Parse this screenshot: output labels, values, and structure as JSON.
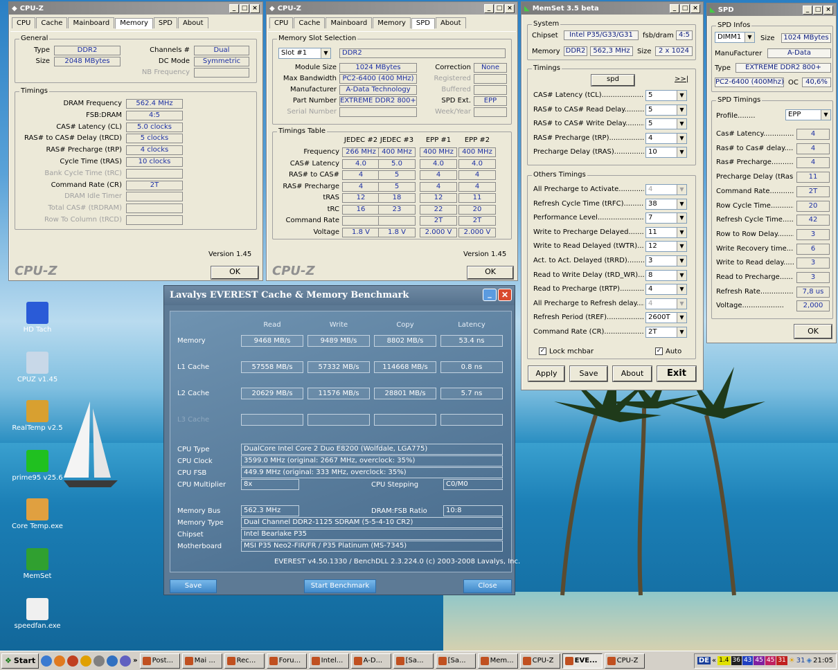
{
  "cpuz1": {
    "title": "CPU-Z",
    "tabs": [
      "CPU",
      "Cache",
      "Mainboard",
      "Memory",
      "SPD",
      "About"
    ],
    "active_tab": "Memory",
    "general_label": "General",
    "type_label": "Type",
    "type_value": "DDR2",
    "size_label": "Size",
    "size_value": "2048 MBytes",
    "channels_label": "Channels #",
    "channels_value": "Dual",
    "dcmode_label": "DC Mode",
    "dcmode_value": "Symmetric",
    "nbfreq_label": "NB Frequency",
    "timings_label": "Timings",
    "rows": [
      {
        "label": "DRAM Frequency",
        "value": "562.4 MHz",
        "dim": false
      },
      {
        "label": "FSB:DRAM",
        "value": "4:5",
        "dim": false
      },
      {
        "label": "CAS# Latency (CL)",
        "value": "5.0 clocks",
        "dim": false
      },
      {
        "label": "RAS# to CAS# Delay (tRCD)",
        "value": "5 clocks",
        "dim": false
      },
      {
        "label": "RAS# Precharge (tRP)",
        "value": "4 clocks",
        "dim": false
      },
      {
        "label": "Cycle Time (tRAS)",
        "value": "10 clocks",
        "dim": false
      },
      {
        "label": "Bank Cycle Time (tRC)",
        "value": "",
        "dim": true
      },
      {
        "label": "Command Rate (CR)",
        "value": "2T",
        "dim": false
      },
      {
        "label": "DRAM Idle Timer",
        "value": "",
        "dim": true
      },
      {
        "label": "Total CAS# (tRDRAM)",
        "value": "",
        "dim": true
      },
      {
        "label": "Row To Column (tRCD)",
        "value": "",
        "dim": true
      }
    ],
    "version": "Version 1.45",
    "logo": "CPU-Z",
    "ok": "OK"
  },
  "cpuz2": {
    "title": "CPU-Z",
    "tabs": [
      "CPU",
      "Cache",
      "Mainboard",
      "Memory",
      "SPD",
      "About"
    ],
    "active_tab": "SPD",
    "slot_group": "Memory Slot Selection",
    "slot_value": "Slot #1",
    "slot_type": "DDR2",
    "module_size_label": "Module Size",
    "module_size": "1024 MBytes",
    "max_bw_label": "Max Bandwidth",
    "max_bw": "PC2-6400 (400 MHz)",
    "manufacturer_label": "Manufacturer",
    "manufacturer": "A-Data Technology",
    "part_label": "Part Number",
    "part": "EXTREME DDR2 800+",
    "serial_label": "Serial Number",
    "correction_label": "Correction",
    "correction": "None",
    "registered_label": "Registered",
    "buffered_label": "Buffered",
    "spdext_label": "SPD Ext.",
    "spdext": "EPP",
    "week_label": "Week/Year",
    "timings_group": "Timings Table",
    "cols": [
      "JEDEC #2",
      "JEDEC #3",
      "EPP #1",
      "EPP #2"
    ],
    "table": [
      {
        "label": "Frequency",
        "v": [
          "266 MHz",
          "400 MHz",
          "400 MHz",
          "400 MHz"
        ]
      },
      {
        "label": "CAS# Latency",
        "v": [
          "4.0",
          "5.0",
          "4.0",
          "4.0"
        ]
      },
      {
        "label": "RAS# to CAS#",
        "v": [
          "4",
          "5",
          "4",
          "4"
        ]
      },
      {
        "label": "RAS# Precharge",
        "v": [
          "4",
          "5",
          "4",
          "4"
        ]
      },
      {
        "label": "tRAS",
        "v": [
          "12",
          "18",
          "12",
          "11"
        ]
      },
      {
        "label": "tRC",
        "v": [
          "16",
          "23",
          "22",
          "20"
        ]
      },
      {
        "label": "Command Rate",
        "v": [
          "",
          "",
          "2T",
          "2T"
        ]
      },
      {
        "label": "Voltage",
        "v": [
          "1.8 V",
          "1.8 V",
          "2.000 V",
          "2.000 V"
        ]
      }
    ],
    "version": "Version 1.45",
    "logo": "CPU-Z",
    "ok": "OK"
  },
  "memset": {
    "title": "MemSet 3.5 beta",
    "system_group": "System",
    "chipset_label": "Chipset",
    "chipset": "Intel P35/G33/G31",
    "fsbdram_label": "fsb/dram",
    "fsbdram": "4:5",
    "memory_label": "Memory",
    "memory_type": "DDR2",
    "memory_freq": "562,3 MHz",
    "size_label": "Size",
    "size": "2 x 1024",
    "timings_group": "Timings",
    "spd_btn": "spd",
    "more_btn": ">>|",
    "timings": [
      {
        "label": "CAS# Latency (tCL)",
        "value": "5",
        "dis": false
      },
      {
        "label": "RAS# to CAS# Read Delay",
        "value": "5",
        "dis": false
      },
      {
        "label": "RAS# to CAS# Write Delay",
        "value": "5",
        "dis": false
      },
      {
        "label": "RAS# Precharge (tRP)",
        "value": "4",
        "dis": false
      },
      {
        "label": "Precharge Delay  (tRAS)",
        "value": "10",
        "dis": false
      }
    ],
    "others_group": "Others Timings",
    "others": [
      {
        "label": "All Precharge to Activate",
        "value": "4",
        "dis": true
      },
      {
        "label": "Refresh Cycle Time (tRFC)",
        "value": "38",
        "dis": false
      },
      {
        "label": "Performance Level",
        "value": "7",
        "dis": false
      },
      {
        "label": "Write to Precharge Delayed",
        "value": "11",
        "dis": false
      },
      {
        "label": "Write to Read Delayed (tWTR)",
        "value": "12",
        "dis": false
      },
      {
        "label": "Act. to Act. Delayed (tRRD)",
        "value": "3",
        "dis": false
      },
      {
        "label": "Read to Write Delay (tRD_WR)",
        "value": "8",
        "dis": false
      },
      {
        "label": "Read to Precharge (tRTP)",
        "value": "4",
        "dis": false
      },
      {
        "label": "All Precharge to Refresh delay",
        "value": "4",
        "dis": true
      },
      {
        "label": "Refresh Period (tREF)",
        "value": "2600T",
        "dis": false
      },
      {
        "label": "Command Rate (CR)",
        "value": "2T",
        "dis": false
      }
    ],
    "lock_label": "Lock mchbar",
    "auto_label": "Auto",
    "apply": "Apply",
    "save": "Save",
    "about": "About",
    "exit": "Exit"
  },
  "spd": {
    "title": "SPD",
    "infos_group": "SPD Infos",
    "dimm": "DIMM1",
    "size_label": "Size",
    "size": "1024 MBytes",
    "manuf_label": "ManuFacturer",
    "manuf": "A-Data",
    "type_label": "Type",
    "type": "EXTREME DDR2 800+",
    "speed": "PC2-6400 (400Mhz)",
    "oc_label": "OC",
    "oc": "40,6%",
    "timings_group": "SPD Timings",
    "profile_label": "Profile",
    "profile": "EPP",
    "rows": [
      {
        "label": "Cas# Latency",
        "value": "4"
      },
      {
        "label": "Ras# to Cas# delay",
        "value": "4"
      },
      {
        "label": "Ras# Precharge",
        "value": "4"
      },
      {
        "label": "Precharge Delay (tRas)",
        "value": "11"
      },
      {
        "label": "Command Rate",
        "value": "2T"
      },
      {
        "label": "Row Cycle Time",
        "value": "20"
      },
      {
        "label": "Refresh Cycle Time",
        "value": "42"
      },
      {
        "label": "Row to Row Delay",
        "value": "3"
      },
      {
        "label": "Write Recovery time",
        "value": "6"
      },
      {
        "label": "Write to Read delay",
        "value": "3"
      },
      {
        "label": "Read to Precharge",
        "value": "3"
      },
      {
        "label": "Refresh Rate",
        "value": "7,8 us"
      },
      {
        "label": "Voltage",
        "value": "2,000"
      }
    ],
    "ok": "OK"
  },
  "everest": {
    "title": "Lavalys EVEREST Cache & Memory Benchmark",
    "cols": [
      "Read",
      "Write",
      "Copy",
      "Latency"
    ],
    "rows": [
      {
        "label": "Memory",
        "v": [
          "9468 MB/s",
          "9489 MB/s",
          "8802 MB/s",
          "53.4 ns"
        ],
        "dim": false
      },
      {
        "label": "L1 Cache",
        "v": [
          "57558 MB/s",
          "57332 MB/s",
          "114668 MB/s",
          "0.8 ns"
        ],
        "dim": false
      },
      {
        "label": "L2 Cache",
        "v": [
          "20629 MB/s",
          "11576 MB/s",
          "28801 MB/s",
          "5.7 ns"
        ],
        "dim": false
      },
      {
        "label": "L3 Cache",
        "v": [
          "",
          "",
          "",
          ""
        ],
        "dim": true
      }
    ],
    "cpu_type_label": "CPU Type",
    "cpu_type": "DualCore Intel Core 2 Duo E8200  (Wolfdale, LGA775)",
    "cpu_clock_label": "CPU Clock",
    "cpu_clock": "3599.0 MHz  (original: 2667 MHz, overclock: 35%)",
    "cpu_fsb_label": "CPU FSB",
    "cpu_fsb": "449.9 MHz  (original: 333 MHz, overclock: 35%)",
    "cpu_mult_label": "CPU Multiplier",
    "cpu_mult": "8x",
    "cpu_step_label": "CPU Stepping",
    "cpu_step": "C0/M0",
    "mem_bus_label": "Memory Bus",
    "mem_bus": "562.3 MHz",
    "ratio_label": "DRAM:FSB Ratio",
    "ratio": "10:8",
    "mem_type_label": "Memory Type",
    "mem_type": "Dual Channel DDR2-1125 SDRAM  (5-5-4-10 CR2)",
    "chipset_label": "Chipset",
    "chipset": "Intel Bearlake P35",
    "mobo_label": "Motherboard",
    "mobo": "MSI P35 Neo2-FIR/FR / P35 Platinum (MS-7345)",
    "footer": "EVEREST v4.50.1330 / BenchDLL 2.3.224.0  (c) 2003-2008 Lavalys, Inc.",
    "save": "Save",
    "start": "Start Benchmark",
    "close": "Close"
  },
  "desktop_icons": [
    {
      "label": "HD Tach",
      "color": "#2a5bd7",
      "icon": "hdtach-icon"
    },
    {
      "label": "CPUZ v1.45",
      "color": "#c8d8e8",
      "icon": "cpuz-icon"
    },
    {
      "label": "RealTemp v2.5",
      "color": "#d8a030",
      "icon": "realtemp-icon"
    },
    {
      "label": "prime95 v25.6",
      "color": "#20c020",
      "icon": "prime95-icon"
    },
    {
      "label": "Core Temp.exe",
      "color": "#e0a040",
      "icon": "coretemp-icon"
    },
    {
      "label": "MemSet",
      "color": "#30a030",
      "icon": "memset-icon"
    },
    {
      "label": "speedfan.exe",
      "color": "#f0f0f0",
      "icon": "speedfan-icon"
    }
  ],
  "taskbar": {
    "start": "Start",
    "items": [
      "Post...",
      "Mai ...",
      "Rec...",
      "Foru...",
      "Intel...",
      "A-D...",
      "[Sa...",
      "[Sa...",
      "Mem...",
      "CPU-Z",
      "EVE...",
      "CPU-Z"
    ],
    "active_item": "EVE...",
    "tray_lang": "DE",
    "tray_nums": [
      {
        "v": "1.4",
        "c": "#e0e000"
      },
      {
        "v": "36",
        "c": "#202020"
      },
      {
        "v": "43",
        "c": "#2040c0"
      },
      {
        "v": "45",
        "c": "#8020a0"
      },
      {
        "v": "45",
        "c": "#c02060"
      },
      {
        "v": "31",
        "c": "#c02020"
      }
    ],
    "tray_extra": "31",
    "clock": "21:05"
  }
}
